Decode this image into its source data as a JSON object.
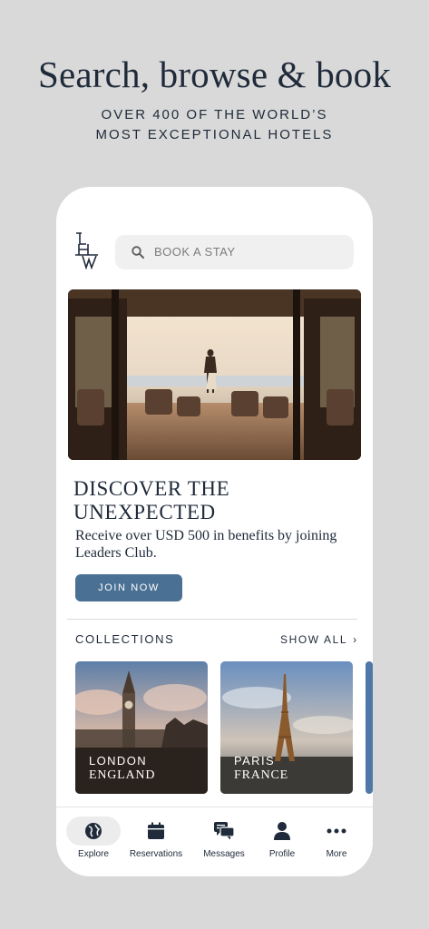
{
  "promo": {
    "headline": "Search, browse & book",
    "subline_1": "OVER 400 OF THE WORLD’S",
    "subline_2": "MOST EXCEPTIONAL HOTELS"
  },
  "app": {
    "logo_text": "LHW",
    "search_placeholder": "BOOK A STAY",
    "hero": {
      "title_line_1": "DISCOVER THE",
      "title_line_2": "UNEXPECTED",
      "text": "Receive over USD 500 in benefits by joining Leaders Club.",
      "button": "JOIN NOW"
    },
    "collections": {
      "label": "COLLECTIONS",
      "show_all": "SHOW ALL",
      "items": [
        {
          "city": "LONDON",
          "country": "ENGLAND"
        },
        {
          "city": "PARIS",
          "country": "FRANCE"
        }
      ]
    },
    "tabs": [
      {
        "label": "Explore",
        "icon": "globe-icon",
        "active": true
      },
      {
        "label": "Reservations",
        "icon": "calendar-icon",
        "active": false
      },
      {
        "label": "Messages",
        "icon": "chat-icon",
        "active": false
      },
      {
        "label": "Profile",
        "icon": "user-icon",
        "active": false
      },
      {
        "label": "More",
        "icon": "more-icon",
        "active": false
      }
    ],
    "colors": {
      "accent": "#4a7094",
      "text": "#1f2a3a",
      "background": "#d9d9d9"
    }
  }
}
